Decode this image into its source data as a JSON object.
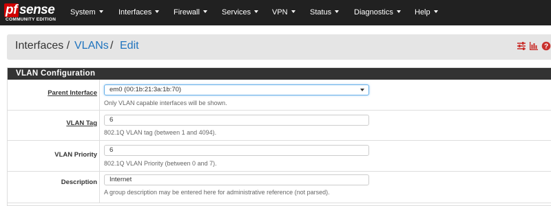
{
  "brand": {
    "logo_pf": "pf",
    "logo_name": "sense",
    "edition": "COMMUNITY EDITION"
  },
  "nav": {
    "items": [
      "System",
      "Interfaces",
      "Firewall",
      "Services",
      "VPN",
      "Status",
      "Diagnostics",
      "Help"
    ]
  },
  "breadcrumb": {
    "root": "Interfaces /",
    "section": "VLANs",
    "separator": "/",
    "current": "Edit"
  },
  "header_icons": [
    "sliders-icon",
    "bar-chart-icon",
    "help-circle-icon"
  ],
  "panel": {
    "title": "VLAN Configuration"
  },
  "form": {
    "parent_interface": {
      "label": "Parent Interface",
      "value": "em0 (00:1b:21:3a:1b:70)",
      "help": "Only VLAN capable interfaces will be shown."
    },
    "vlan_tag": {
      "label": "VLAN Tag",
      "value": "6",
      "help": "802.1Q VLAN tag (between 1 and 4094)."
    },
    "vlan_priority": {
      "label": "VLAN Priority",
      "value": "6",
      "help": "802.1Q VLAN Priority (between 0 and 7)."
    },
    "description": {
      "label": "Description",
      "value": "Internet",
      "help": "A group description may be entered here for administrative reference (not parsed)."
    }
  },
  "colors": {
    "navbar": "#212121",
    "logo_red": "#d00000",
    "link": "#1e73be",
    "panel_heading": "#333333",
    "icon_red": "#c9302c"
  }
}
